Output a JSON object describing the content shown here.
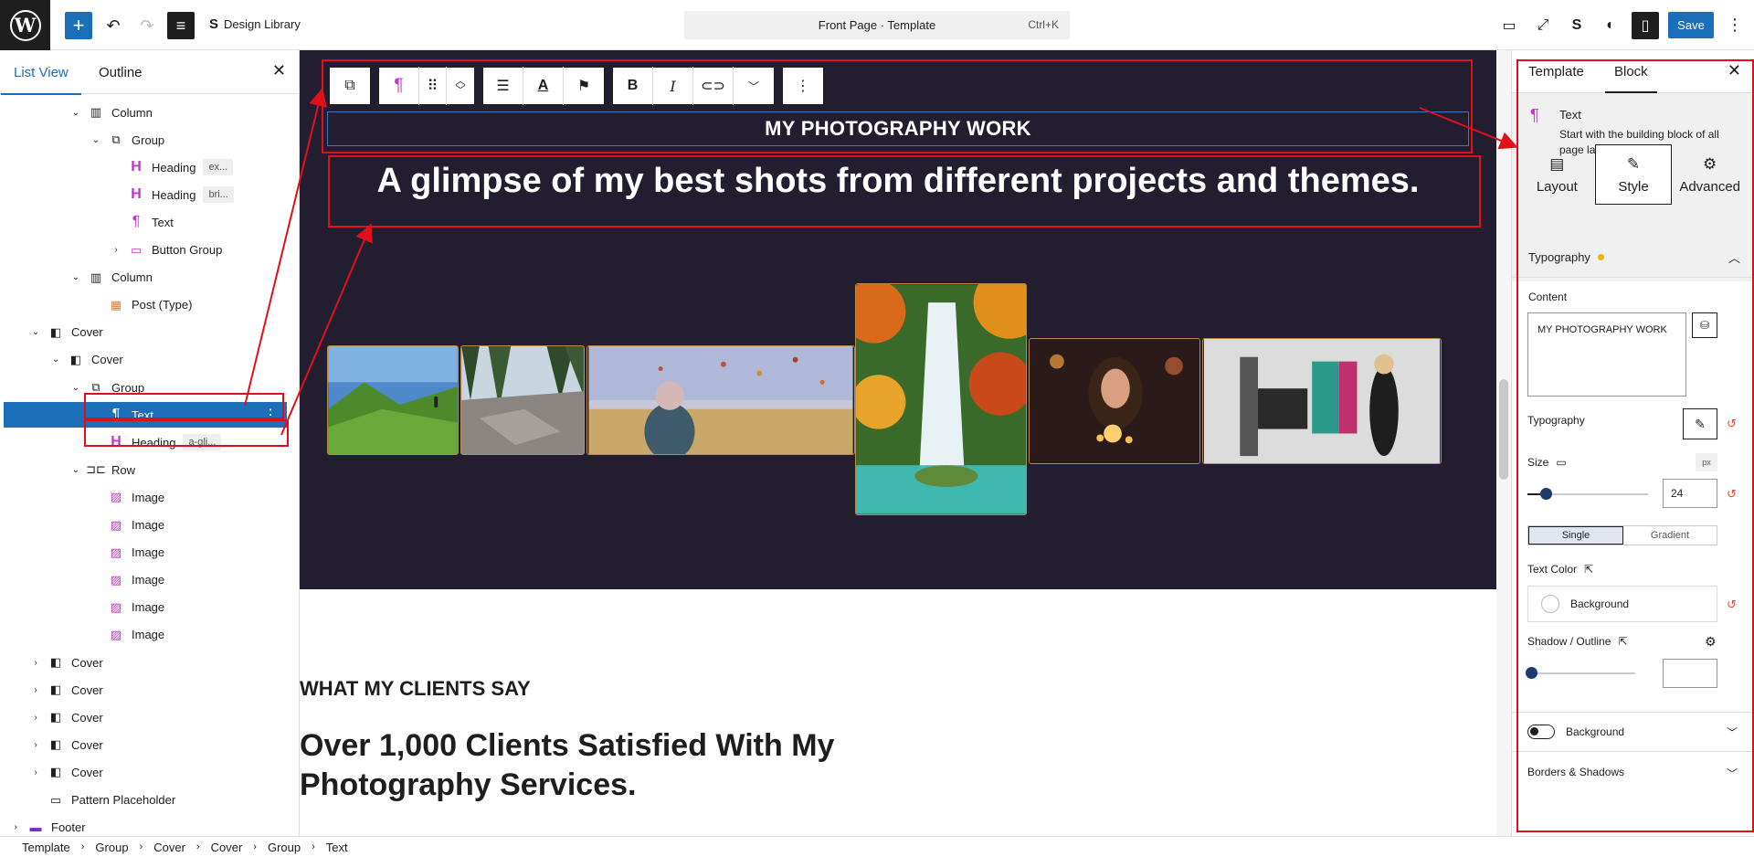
{
  "topbar": {
    "logo": "W",
    "add_icon": "+",
    "undo_icon": "↶",
    "redo_icon": "↷",
    "list_icon": "≡",
    "design_library_label": "Design Library",
    "document_title": "Front Page · Template",
    "shortcut": "Ctrl+K",
    "save_label": "Save",
    "more_icon": "⋮"
  },
  "left_panel": {
    "tabs": [
      "List View",
      "Outline"
    ],
    "close_icon": "✕",
    "tree": [
      {
        "label": "Column",
        "level": 3,
        "icon": "column",
        "chev": "v"
      },
      {
        "label": "Group",
        "level": 4,
        "icon": "group",
        "chev": "v"
      },
      {
        "label": "Heading",
        "level": 5,
        "icon": "heading",
        "badge": "ex..."
      },
      {
        "label": "Heading",
        "level": 5,
        "icon": "heading",
        "badge": "bri..."
      },
      {
        "label": "Text",
        "level": 5,
        "icon": "text"
      },
      {
        "label": "Button Group",
        "level": 5,
        "icon": "button",
        "chev": ">"
      },
      {
        "label": "Column",
        "level": 3,
        "icon": "column",
        "chev": "v"
      },
      {
        "label": "Post (Type)",
        "level": 4,
        "icon": "post"
      },
      {
        "label": "Cover",
        "level": 1,
        "icon": "cover",
        "chev": "v"
      },
      {
        "label": "Cover",
        "level": 2,
        "icon": "cover",
        "chev": "v"
      },
      {
        "label": "Group",
        "level": 3,
        "icon": "group",
        "chev": "v"
      },
      {
        "label": "Text",
        "level": 4,
        "icon": "text",
        "selected": true
      },
      {
        "label": "Heading",
        "level": 4,
        "icon": "heading",
        "badge": "a-gli..."
      },
      {
        "label": "Row",
        "level": 3,
        "icon": "row",
        "chev": "v"
      },
      {
        "label": "Image",
        "level": 4,
        "icon": "image"
      },
      {
        "label": "Image",
        "level": 4,
        "icon": "image"
      },
      {
        "label": "Image",
        "level": 4,
        "icon": "image"
      },
      {
        "label": "Image",
        "level": 4,
        "icon": "image"
      },
      {
        "label": "Image",
        "level": 4,
        "icon": "image"
      },
      {
        "label": "Image",
        "level": 4,
        "icon": "image"
      },
      {
        "label": "Cover",
        "level": 1,
        "icon": "cover",
        "chev": ">"
      },
      {
        "label": "Cover",
        "level": 1,
        "icon": "cover",
        "chev": ">"
      },
      {
        "label": "Cover",
        "level": 1,
        "icon": "cover",
        "chev": ">"
      },
      {
        "label": "Cover",
        "level": 1,
        "icon": "cover",
        "chev": ">"
      },
      {
        "label": "Cover",
        "level": 1,
        "icon": "cover",
        "chev": ">"
      },
      {
        "label": "Pattern Placeholder",
        "level": 1,
        "icon": "pattern"
      },
      {
        "label": "Footer",
        "level": 0,
        "icon": "footer",
        "chev": ">"
      }
    ]
  },
  "canvas": {
    "hero_title": "MY PHOTOGRAPHY WORK",
    "hero_heading": "A glimpse of my best shots from different projects and themes.",
    "section_title": "WHAT MY CLIENTS SAY",
    "section_heading": "Over 1,000 Clients Satisfied With My Photography Services.",
    "photos": [
      "mountain-hiker",
      "rocky-forest",
      "balloon-traveler",
      "waterfall",
      "lights-portrait",
      "fashion-shoot"
    ]
  },
  "right_panel": {
    "tabs": [
      "Template",
      "Block"
    ],
    "active_tab": "Block",
    "close_icon": "✕",
    "block_name": "Text",
    "block_description": "Start with the building block of all page layouts.",
    "seg_tabs": [
      "Layout",
      "Style",
      "Advanced"
    ],
    "typography_section": "Typography",
    "content_label": "Content",
    "content_value": "MY PHOTOGRAPHY WORK",
    "typography_label": "Typography",
    "size_label": "Size",
    "size_unit": "px",
    "size_value": "24",
    "size_slider": 0.12,
    "color_modes": [
      "Single",
      "Gradient"
    ],
    "text_color_label": "Text Color",
    "color_value": "Background",
    "shadow_label": "Shadow / Outline",
    "shadow_slider": 0,
    "background_toggle_label": "Background",
    "borders_label": "Borders & Shadows"
  },
  "breadcrumb": [
    "Template",
    "Group",
    "Cover",
    "Cover",
    "Group",
    "Text"
  ],
  "colors": {
    "accent": "#1a6fb8",
    "hero_bg": "#221d2f",
    "annotation": "#e0101a",
    "block_icon": "#c236c2"
  }
}
